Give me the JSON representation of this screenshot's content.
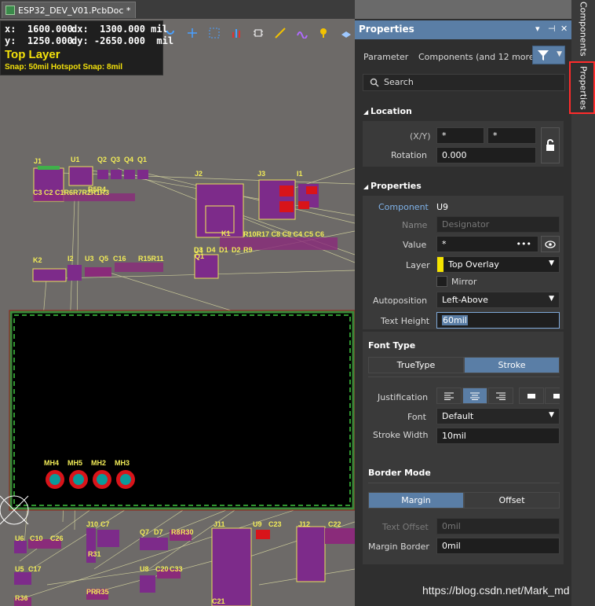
{
  "document_tab": {
    "title": "ESP32_DEV_V01.PcbDoc *"
  },
  "hud": {
    "x": "x:  1600.000",
    "dx": "dx:  1300.000 mil",
    "y": "y:  1250.000",
    "dy": "dy: -2650.000  mil",
    "layer": "Top Layer",
    "snap": "Snap: 50mil Hotspot Snap: 8mil"
  },
  "toolbar": {
    "icons": [
      "route-icon",
      "cross-icon",
      "select-rect-icon",
      "chart-icon",
      "chip-icon",
      "track-icon",
      "wave-icon",
      "probe-icon",
      "layer-icon"
    ]
  },
  "pcb": {
    "designators_top": [
      "J1",
      "U1",
      "Q2",
      "Q3",
      "Q4",
      "Q1",
      "J2",
      "J3",
      "I1",
      "K2",
      "I2",
      "U3",
      "Q5",
      "C16",
      "K1",
      "U4",
      "D3",
      "D4",
      "D1",
      "D2",
      "R9"
    ],
    "row_labels": [
      "C3 C2 C1R6R7R2R1R3",
      "R10R17 C8 C9 C4 C5 C6",
      "R15R11",
      "R5R4",
      "Q1"
    ],
    "mount_holes": [
      "MH4",
      "MH5",
      "MH2",
      "MH3"
    ],
    "designators_bottom": [
      "U6",
      "C10",
      "C26",
      "J10",
      "C7",
      "Q7",
      "D7",
      "R8",
      "R30",
      "J11",
      "U9",
      "C23",
      "J12",
      "C22",
      "U5",
      "C17",
      "U8",
      "C20",
      "C33",
      "R31",
      "PR",
      "R35",
      "R36",
      "C21"
    ]
  },
  "panel": {
    "title": "Properties",
    "header_buttons": [
      "▾",
      "⊣",
      "✕"
    ],
    "parameter_label": "Parameter",
    "filter_text": "Components (and 12 more)",
    "search_placeholder": "Search",
    "location": {
      "title": "Location",
      "xy_label": "(X/Y)",
      "x_value": "*",
      "y_value": "*",
      "rotation_label": "Rotation",
      "rotation_value": "0.000"
    },
    "properties": {
      "title": "Properties",
      "component_label": "Component",
      "component_value": "U9",
      "name_label": "Name",
      "name_value": "Designator",
      "value_label": "Value",
      "value_value": "*",
      "value_more": "•••",
      "layer_label": "Layer",
      "layer_value": "Top Overlay",
      "layer_color": "#f5e400",
      "mirror_label": "Mirror",
      "autoposition_label": "Autoposition",
      "autoposition_value": "Left-Above",
      "text_height_label": "Text Height",
      "text_height_value": "60mil"
    },
    "font_type": {
      "title": "Font Type",
      "options": [
        "TrueType",
        "Stroke"
      ],
      "selected": "Stroke",
      "justification_label": "Justification",
      "font_label": "Font",
      "font_value": "Default",
      "stroke_width_label": "Stroke Width",
      "stroke_width_value": "10mil"
    },
    "border_mode": {
      "title": "Border Mode",
      "options": [
        "Margin",
        "Offset"
      ],
      "selected": "Margin",
      "text_offset_label": "Text Offset",
      "text_offset_value": "0mil",
      "margin_border_label": "Margin Border",
      "margin_border_value": "0mil"
    }
  },
  "side_tabs": {
    "components": "Components",
    "properties": "Properties"
  },
  "colors": {
    "accent": "#5a7ea6",
    "highlight": "#ff2b2b",
    "silkscreen": "#f2ec58",
    "board": "#000000"
  },
  "watermark": "https://blog.csdn.net/Mark_md"
}
